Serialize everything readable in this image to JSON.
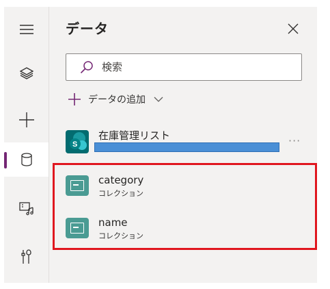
{
  "rail": {
    "items": [
      {
        "icon": "hamburger-menu-icon"
      },
      {
        "icon": "layers-icon"
      },
      {
        "icon": "plus-icon"
      },
      {
        "icon": "database-icon",
        "active": true
      },
      {
        "icon": "media-icon"
      },
      {
        "icon": "tools-icon"
      }
    ],
    "accent_color": "#742774"
  },
  "panel": {
    "title": "データ",
    "search": {
      "placeholder": "検索",
      "value": ""
    },
    "add_data_label": "データの追加",
    "source": {
      "name": "在庫管理リスト",
      "icon": "sharepoint-icon",
      "more_label": "···"
    },
    "collections": [
      {
        "name": "category",
        "type": "コレクション",
        "icon": "collection-icon"
      },
      {
        "name": "name",
        "type": "コレクション",
        "icon": "collection-icon"
      }
    ]
  },
  "colors": {
    "panel_bg": "#f3f2f1",
    "collection_icon": "#4a9b93",
    "highlight": "#e0171f",
    "redaction_bar": "#4a8fd6"
  }
}
